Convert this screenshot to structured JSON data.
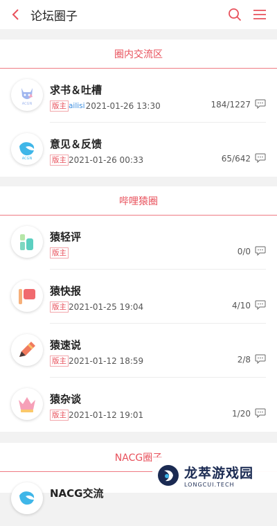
{
  "header": {
    "title": "论坛圈子",
    "back_icon": "chevron-left-icon",
    "search_icon": "search-icon",
    "menu_icon": "menu-icon",
    "accent": "#e8505b"
  },
  "sections": [
    {
      "title": "圈内交流区",
      "items": [
        {
          "name": "求书＆吐槽",
          "badge": "版主",
          "moderator": "ailisi",
          "time": "2021-01-26 13:30",
          "count": "184/1227",
          "icon": "cat-logo-avatar"
        },
        {
          "name": "意见＆反馈",
          "badge": "版主",
          "moderator": "",
          "time": "2021-01-26 00:33",
          "count": "65/642",
          "icon": "wave-logo-avatar"
        }
      ]
    },
    {
      "title": "哔哩猿圈",
      "items": [
        {
          "name": "猿轻评",
          "badge": "版主",
          "moderator": "",
          "time": "",
          "count": "0/0",
          "icon": "bars-avatar"
        },
        {
          "name": "猿快报",
          "badge": "版主",
          "moderator": "",
          "time": "2021-01-25 19:04",
          "count": "4/10",
          "icon": "flag-avatar"
        },
        {
          "name": "猿速说",
          "badge": "版主",
          "moderator": "",
          "time": "2021-01-12 18:59",
          "count": "2/8",
          "icon": "pencil-avatar"
        },
        {
          "name": "猿杂谈",
          "badge": "版主",
          "moderator": "",
          "time": "2021-01-12 19:01",
          "count": "1/20",
          "icon": "crown-avatar"
        }
      ]
    },
    {
      "title": "NACG圈子",
      "items": [
        {
          "name": "NACG交流",
          "icon": "wave-logo-avatar"
        }
      ]
    }
  ],
  "watermark": {
    "main": "龙萃游戏园",
    "sub": "LONGCUI.TECH"
  }
}
